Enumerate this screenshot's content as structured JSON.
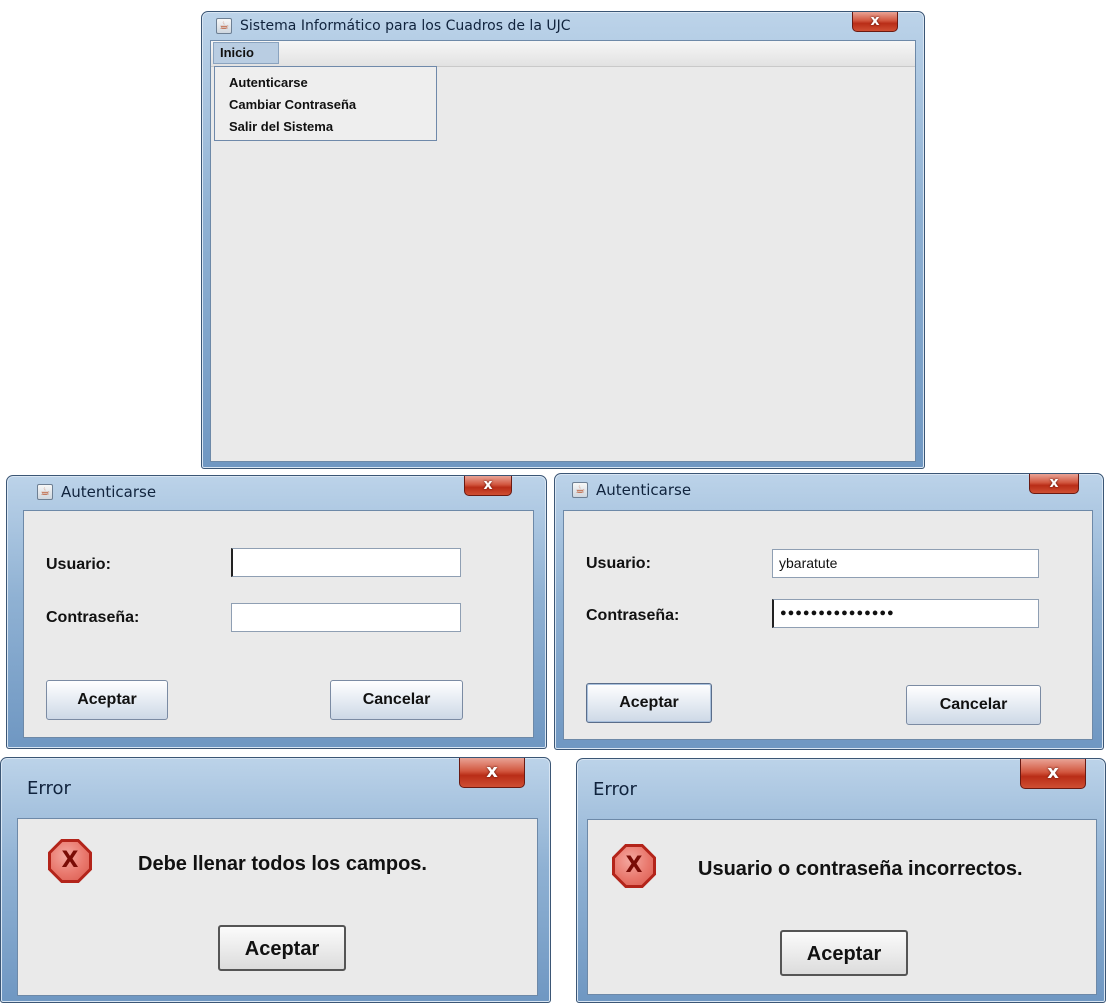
{
  "main_window": {
    "title": "Sistema Informático para los Cuadros de la UJC",
    "menu": {
      "label": "Inicio",
      "items": [
        "Autenticarse",
        "Cambiar Contraseña",
        "Salir del Sistema"
      ]
    },
    "close_label": "x"
  },
  "login_empty": {
    "title": "Autenticarse",
    "user_label": "Usuario:",
    "user_value": "",
    "password_label": "Contraseña:",
    "password_value": "",
    "accept_label": "Aceptar",
    "cancel_label": "Cancelar",
    "close_label": "x"
  },
  "login_filled": {
    "title": "Autenticarse",
    "user_label": "Usuario:",
    "user_value": "ybaratute",
    "password_label": "Contraseña:",
    "password_value": "●●●●●●●●●●●●●●●",
    "accept_label": "Aceptar",
    "cancel_label": "Cancelar",
    "close_label": "x"
  },
  "error_empty": {
    "title": "Error",
    "message": "Debe llenar todos los campos.",
    "accept_label": "Aceptar",
    "icon_glyph": "X",
    "close_label": "x"
  },
  "error_invalid": {
    "title": "Error",
    "message": "Usuario o contraseña incorrectos.",
    "accept_label": "Aceptar",
    "icon_glyph": "X",
    "close_label": "x"
  },
  "icons": {
    "app": "java-cup-icon",
    "error": "error-stop-icon",
    "close": "close-icon"
  },
  "colors": {
    "title_bar": "#8fb1d3",
    "client_background": "#eaeaea",
    "close_button": "#c9432a",
    "error_icon": "#b3241a"
  }
}
